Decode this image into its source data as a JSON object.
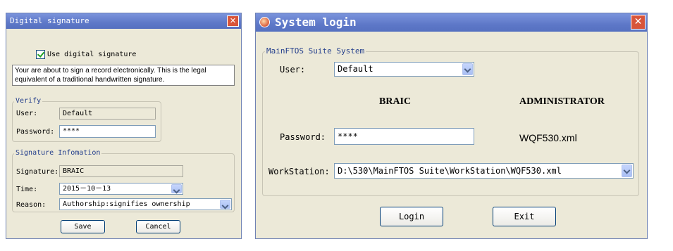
{
  "digital_signature": {
    "title": "Digital signature",
    "use_checkbox_label": "Use digital signature",
    "use_checked": true,
    "notice": "Your are about to sign a record electronically. This is the legal equivalent of a traditional handwritten signature.",
    "verify": {
      "legend": "Verify",
      "user_label": "User:",
      "user_value": "Default",
      "password_label": "Password:",
      "password_value": "****"
    },
    "info": {
      "legend": "Signature Infomation",
      "signature_label": "Signature:",
      "signature_value": "BRAIC",
      "time_label": "Time:",
      "time_value": "2015－10－13",
      "reason_label": "Reason:",
      "reason_value": "Authorship:signifies ownership"
    },
    "save_label": "Save",
    "cancel_label": "Cancel"
  },
  "system_login": {
    "title": "System login",
    "group_legend": "MainFTOS Suite System",
    "user_label": "User:",
    "user_value": "Default",
    "user_name": "BRAIC",
    "role": "ADMINISTRATOR",
    "password_label": "Password:",
    "password_value": "****",
    "config_file": "WQF530.xml",
    "workstation_label": "WorkStation:",
    "workstation_value": "D:\\530\\MainFTOS Suite\\WorkStation\\WQF530.xml",
    "login_label": "Login",
    "exit_label": "Exit"
  }
}
